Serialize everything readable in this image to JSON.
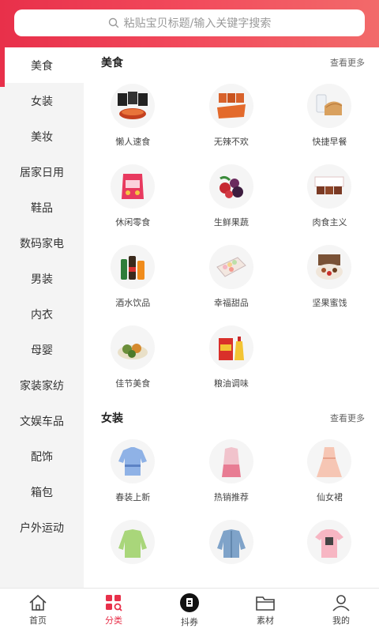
{
  "search": {
    "placeholder": "粘贴宝贝标题/输入关键字搜索"
  },
  "sidebar": {
    "items": [
      {
        "label": "美食",
        "active": true
      },
      {
        "label": "女装"
      },
      {
        "label": "美妆"
      },
      {
        "label": "居家日用"
      },
      {
        "label": "鞋品"
      },
      {
        "label": "数码家电"
      },
      {
        "label": "男装"
      },
      {
        "label": "内衣"
      },
      {
        "label": "母婴"
      },
      {
        "label": "家装家纺"
      },
      {
        "label": "文娱车品"
      },
      {
        "label": "配饰"
      },
      {
        "label": "箱包"
      },
      {
        "label": "户外运动"
      }
    ]
  },
  "sections": [
    {
      "title": "美食",
      "more": "查看更多",
      "items": [
        {
          "label": "懒人速食",
          "icon": "instant-noodles-icon"
        },
        {
          "label": "无辣不欢",
          "icon": "spicy-snack-icon"
        },
        {
          "label": "快捷早餐",
          "icon": "bread-icon"
        },
        {
          "label": "休闲零食",
          "icon": "chips-icon"
        },
        {
          "label": "生鲜果蔬",
          "icon": "berries-icon"
        },
        {
          "label": "肉食主义",
          "icon": "meat-icon"
        },
        {
          "label": "酒水饮品",
          "icon": "drinks-icon"
        },
        {
          "label": "幸福甜品",
          "icon": "dessert-icon"
        },
        {
          "label": "坚果蜜饯",
          "icon": "nuts-icon"
        },
        {
          "label": "佳节美食",
          "icon": "festival-food-icon"
        },
        {
          "label": "粮油调味",
          "icon": "oil-rice-icon"
        }
      ]
    },
    {
      "title": "女装",
      "more": "查看更多",
      "items": [
        {
          "label": "春装上新",
          "icon": "blouse-icon"
        },
        {
          "label": "热销推荐",
          "icon": "outfit-icon"
        },
        {
          "label": "仙女裙",
          "icon": "dress-icon"
        },
        {
          "label": "",
          "icon": "sweater-icon"
        },
        {
          "label": "",
          "icon": "denim-jacket-icon"
        },
        {
          "label": "",
          "icon": "tshirt-icon"
        }
      ]
    }
  ],
  "bottom_nav": [
    {
      "label": "首页",
      "icon": "home-icon"
    },
    {
      "label": "分类",
      "icon": "category-icon",
      "active": true
    },
    {
      "label": "抖券",
      "icon": "douyin-icon"
    },
    {
      "label": "素材",
      "icon": "folder-icon"
    },
    {
      "label": "我的",
      "icon": "user-icon"
    }
  ],
  "colors": {
    "accent": "#e8304a"
  }
}
